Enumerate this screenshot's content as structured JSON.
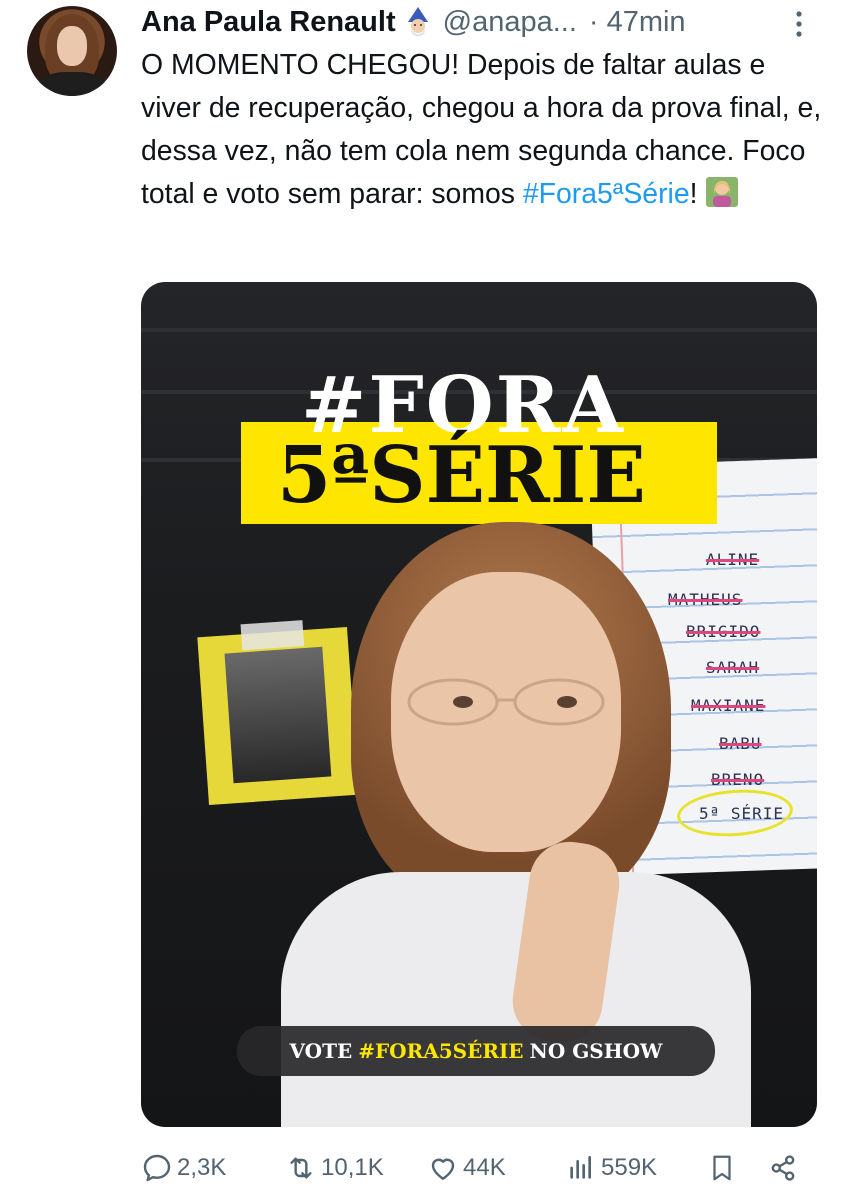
{
  "tweet": {
    "author_name": "Ana Paula Renault",
    "handle": "@anapa...",
    "separator": "·",
    "time": "47min",
    "text_parts": {
      "before_hashtag": "O MOMENTO CHEGOU! Depois de faltar aulas e viver de recuperação, chegou a hora da prova final, e, dessa vez, não tem cola nem segunda chance. Foco total e voto sem parar: somos ",
      "hashtag": "#Fora5ªSérie",
      "after_hashtag": "!"
    }
  },
  "media": {
    "headline_top": "#FORA",
    "headline_bottom": "5ªSÉRIE",
    "list_items": [
      {
        "text": "ALINE",
        "struck": true
      },
      {
        "text": "MATHEUS",
        "struck": true
      },
      {
        "text": "BRIGIDO",
        "struck": true
      },
      {
        "text": "SARAH",
        "struck": true
      },
      {
        "text": "MAXIANE",
        "struck": true
      },
      {
        "text": "BABU",
        "struck": true
      },
      {
        "text": "BRENO",
        "struck": true
      },
      {
        "text": "5ª SÉRIE",
        "struck": false
      }
    ],
    "vote_prefix": "VOTE",
    "vote_hashtag": "#FORA5SÉRIE",
    "vote_suffix": "NO GSHOW"
  },
  "actions": {
    "replies": "2,3K",
    "reposts": "10,1K",
    "likes": "44K",
    "views": "559K"
  },
  "icons": {
    "reply": "reply-icon",
    "repost": "repost-icon",
    "like": "heart-icon",
    "views": "views-icon",
    "bookmark": "bookmark-icon",
    "share": "share-icon",
    "more": "more-options-icon"
  },
  "colors": {
    "text": "#0f1419",
    "muted": "#536471",
    "link": "#1d9bf0",
    "accent_yellow": "#ffe600"
  }
}
